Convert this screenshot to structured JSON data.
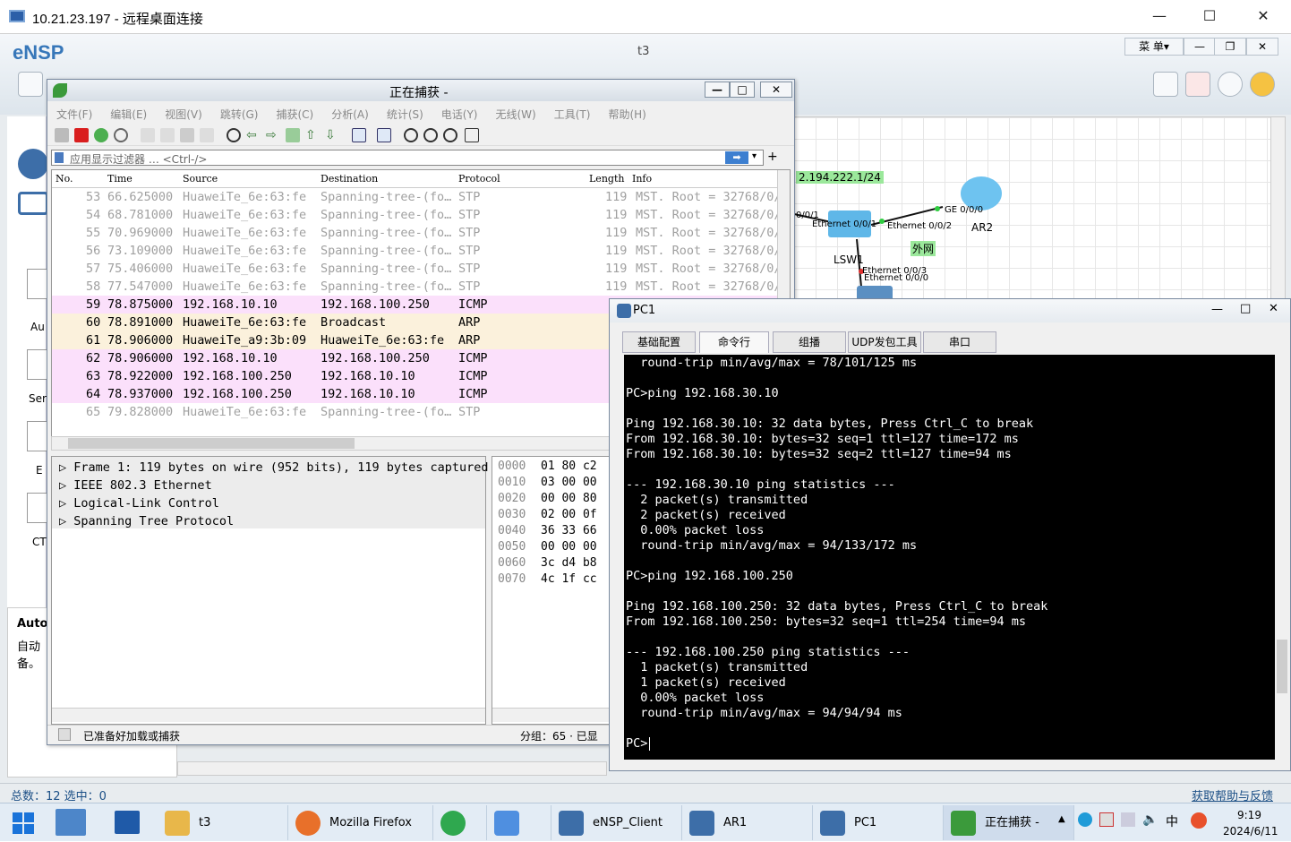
{
  "rdp": {
    "title": "10.21.23.197 - 远程桌面连接",
    "min": "—",
    "max": "☐",
    "close": "✕"
  },
  "ensp": {
    "logo": "eNSP",
    "project": "t3",
    "menu": "菜 单▾",
    "min": "—",
    "restore": "❐",
    "close": "✕",
    "sidebar_labels": [
      "Au",
      "Ser",
      "E",
      "CT"
    ],
    "desc_title": "Auto",
    "desc_text": "自动\n备。",
    "status_left": "总数：12  选中：0",
    "status_right": "获取帮助与反馈",
    "topology": {
      "ip_label": "2.194.222.1/24",
      "lsw_label": "LSW1",
      "ar_label": "AR2",
      "iface_a": "0/0/1",
      "iface_b": "Ethernet 0/0/1",
      "iface_c": "Ethernet 0/0/2",
      "iface_d": "GE 0/0/0",
      "iface_e": "Ethernet 0/0/3",
      "iface_f": "Ethernet 0/0/0",
      "net_label": "外网"
    }
  },
  "wireshark": {
    "title": "正在捕获 -",
    "menu": [
      "文件(F)",
      "编辑(E)",
      "视图(V)",
      "跳转(G)",
      "捕获(C)",
      "分析(A)",
      "统计(S)",
      "电话(Y)",
      "无线(W)",
      "工具(T)",
      "帮助(H)"
    ],
    "filter_placeholder": "应用显示过滤器 … <Ctrl-/>",
    "columns": [
      "No.",
      "Time",
      "Source",
      "Destination",
      "Protocol",
      "Length",
      "Info"
    ],
    "packets": [
      {
        "no": "53",
        "time": "66.625000",
        "src": "HuaweiTe_6e:63:fe",
        "dst": "Spanning-tree-(fo…",
        "proto": "STP",
        "len": "119",
        "info": "MST. Root = 32768/0/",
        "kind": "stp"
      },
      {
        "no": "54",
        "time": "68.781000",
        "src": "HuaweiTe_6e:63:fe",
        "dst": "Spanning-tree-(fo…",
        "proto": "STP",
        "len": "119",
        "info": "MST. Root = 32768/0/",
        "kind": "stp"
      },
      {
        "no": "55",
        "time": "70.969000",
        "src": "HuaweiTe_6e:63:fe",
        "dst": "Spanning-tree-(fo…",
        "proto": "STP",
        "len": "119",
        "info": "MST. Root = 32768/0/",
        "kind": "stp"
      },
      {
        "no": "56",
        "time": "73.109000",
        "src": "HuaweiTe_6e:63:fe",
        "dst": "Spanning-tree-(fo…",
        "proto": "STP",
        "len": "119",
        "info": "MST. Root = 32768/0/",
        "kind": "stp"
      },
      {
        "no": "57",
        "time": "75.406000",
        "src": "HuaweiTe_6e:63:fe",
        "dst": "Spanning-tree-(fo…",
        "proto": "STP",
        "len": "119",
        "info": "MST. Root = 32768/0/",
        "kind": "stp"
      },
      {
        "no": "58",
        "time": "77.547000",
        "src": "HuaweiTe_6e:63:fe",
        "dst": "Spanning-tree-(fo…",
        "proto": "STP",
        "len": "119",
        "info": "MST. Root = 32768/0/",
        "kind": "stp"
      },
      {
        "no": "59",
        "time": "78.875000",
        "src": "192.168.10.10",
        "dst": "192.168.100.250",
        "proto": "ICMP",
        "len": "",
        "info": "",
        "kind": "icmp"
      },
      {
        "no": "60",
        "time": "78.891000",
        "src": "HuaweiTe_6e:63:fe",
        "dst": "Broadcast",
        "proto": "ARP",
        "len": "",
        "info": "",
        "kind": "arp"
      },
      {
        "no": "61",
        "time": "78.906000",
        "src": "HuaweiTe_a9:3b:09",
        "dst": "HuaweiTe_6e:63:fe",
        "proto": "ARP",
        "len": "",
        "info": "",
        "kind": "arp"
      },
      {
        "no": "62",
        "time": "78.906000",
        "src": "192.168.10.10",
        "dst": "192.168.100.250",
        "proto": "ICMP",
        "len": "",
        "info": "",
        "kind": "icmp"
      },
      {
        "no": "63",
        "time": "78.922000",
        "src": "192.168.100.250",
        "dst": "192.168.10.10",
        "proto": "ICMP",
        "len": "",
        "info": "",
        "kind": "icmp"
      },
      {
        "no": "64",
        "time": "78.937000",
        "src": "192.168.100.250",
        "dst": "192.168.10.10",
        "proto": "ICMP",
        "len": "",
        "info": "",
        "kind": "icmp"
      },
      {
        "no": "65",
        "time": "79.828000",
        "src": "HuaweiTe_6e:63:fe",
        "dst": "Spanning-tree-(fo…",
        "proto": "STP",
        "len": "",
        "info": "",
        "kind": "stp"
      }
    ],
    "details": [
      "Frame 1: 119 bytes on wire (952 bits), 119 bytes captured",
      "IEEE 802.3 Ethernet",
      "Logical-Link Control",
      "Spanning Tree Protocol"
    ],
    "hex": [
      {
        "off": "0000",
        "bytes": "01 80 c2"
      },
      {
        "off": "0010",
        "bytes": "03 00 00"
      },
      {
        "off": "0020",
        "bytes": "00 00 80"
      },
      {
        "off": "0030",
        "bytes": "02 00 0f"
      },
      {
        "off": "0040",
        "bytes": "36 33 66"
      },
      {
        "off": "0050",
        "bytes": "00 00 00"
      },
      {
        "off": "0060",
        "bytes": "3c d4 b8"
      },
      {
        "off": "0070",
        "bytes": "4c 1f cc"
      }
    ],
    "status_left": "已准备好加载或捕获",
    "status_right": "分组：65 · 已显"
  },
  "pc1": {
    "title": "PC1",
    "tabs": [
      "基础配置",
      "命令行",
      "组播",
      "UDP发包工具",
      "串口"
    ],
    "terminal": [
      "  round-trip min/avg/max = 78/101/125 ms",
      "",
      "PC>ping 192.168.30.10",
      "",
      "Ping 192.168.30.10: 32 data bytes, Press Ctrl_C to break",
      "From 192.168.30.10: bytes=32 seq=1 ttl=127 time=172 ms",
      "From 192.168.30.10: bytes=32 seq=2 ttl=127 time=94 ms",
      "",
      "--- 192.168.30.10 ping statistics ---",
      "  2 packet(s) transmitted",
      "  2 packet(s) received",
      "  0.00% packet loss",
      "  round-trip min/avg/max = 94/133/172 ms",
      "",
      "PC>ping 192.168.100.250",
      "",
      "Ping 192.168.100.250: 32 data bytes, Press Ctrl_C to break",
      "From 192.168.100.250: bytes=32 seq=1 ttl=254 time=94 ms",
      "",
      "--- 192.168.100.250 ping statistics ---",
      "  1 packet(s) transmitted",
      "  1 packet(s) received",
      "  0.00% packet loss",
      "  round-trip min/avg/max = 94/94/94 ms",
      "",
      "PC>"
    ]
  },
  "taskbar": {
    "items": [
      {
        "label": "t3",
        "icon": "folder-icon"
      },
      {
        "label": "Mozilla Firefox",
        "icon": "firefox-icon"
      },
      {
        "label": "",
        "icon": "chrome-icon"
      },
      {
        "label": "",
        "icon": "app-icon"
      },
      {
        "label": "eNSP_Client",
        "icon": "ensp-icon"
      },
      {
        "label": "AR1",
        "icon": "ensp-icon"
      },
      {
        "label": "PC1",
        "icon": "ensp-icon"
      },
      {
        "label": "正在捕获 -",
        "icon": "wireshark-icon"
      }
    ],
    "ime": "中",
    "time": "9:19",
    "date": "2024/6/11"
  }
}
